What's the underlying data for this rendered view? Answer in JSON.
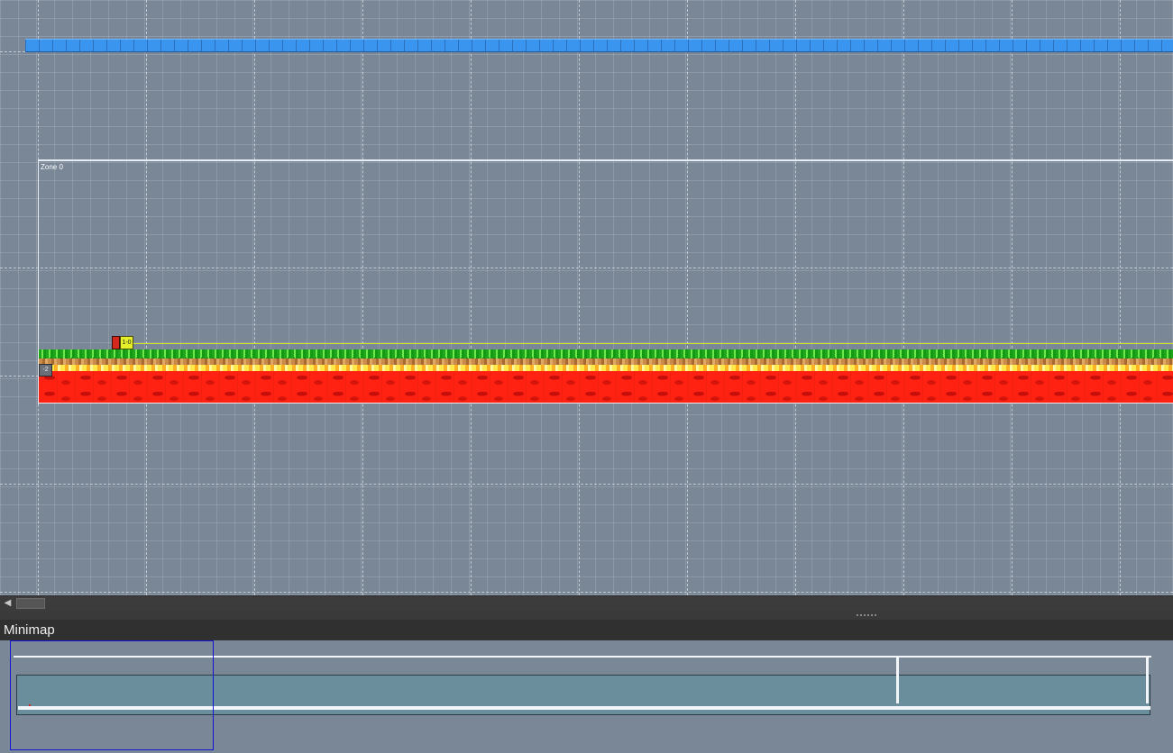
{
  "canvas": {
    "zone_label": "Zone 0",
    "background_color": "#7a8797",
    "grid_color": "#ffffff",
    "markers": {
      "red_label": "",
      "yellow_label": "1-0",
      "gray_label": "-2"
    },
    "tiles": {
      "blue_block": "#3a95ee",
      "grass": "#1fa61a",
      "dirt": "#c98a4a",
      "lava": "#ff2213",
      "lava_surface": "#ffe84a"
    }
  },
  "scrollbar": {
    "left_arrow_icon": "triangle-left-icon"
  },
  "minimap": {
    "title": "Minimap",
    "viewport_color": "#1515d8",
    "level_fill": "#6a8e9c"
  }
}
